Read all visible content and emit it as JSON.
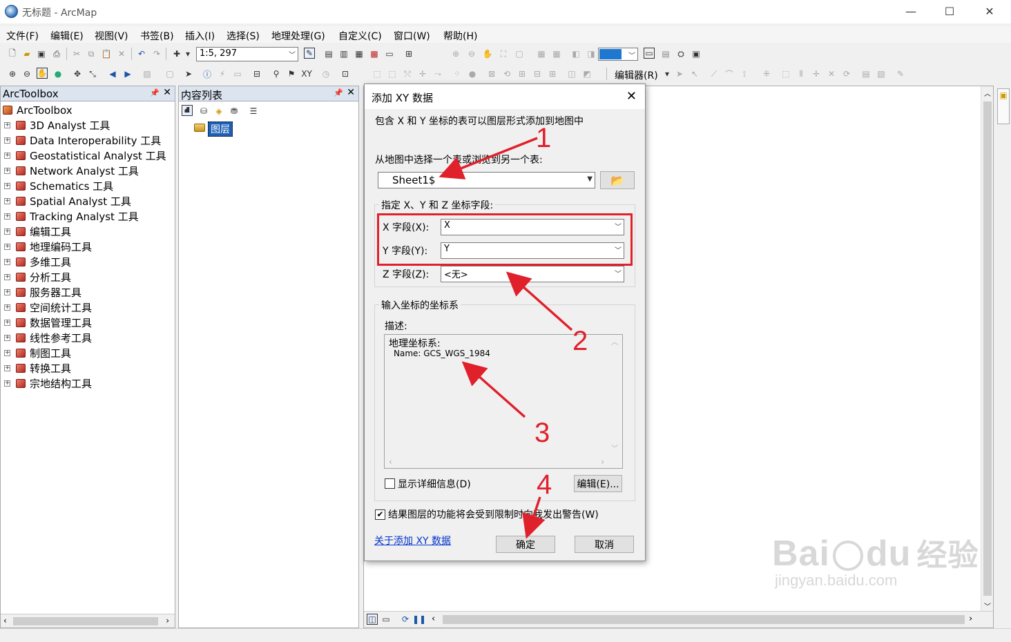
{
  "window": {
    "title": "无标题 - ArcMap",
    "min": "—",
    "max": "☐",
    "close": "✕"
  },
  "menu": [
    "文件(F)",
    "编辑(E)",
    "视图(V)",
    "书签(B)",
    "插入(I)",
    "选择(S)",
    "地理处理(G)",
    "自定义(C)",
    "窗口(W)",
    "帮助(H)"
  ],
  "toolbar": {
    "scale": "1:5, 297",
    "editor_label": "编辑器(R)"
  },
  "toolbox": {
    "title": "ArcToolbox",
    "root": "ArcToolbox",
    "items": [
      "3D Analyst 工具",
      "Data Interoperability 工具",
      "Geostatistical Analyst 工具",
      "Network Analyst 工具",
      "Schematics 工具",
      "Spatial Analyst 工具",
      "Tracking Analyst 工具",
      "编辑工具",
      "地理编码工具",
      "多维工具",
      "分析工具",
      "服务器工具",
      "空间统计工具",
      "数据管理工具",
      "线性参考工具",
      "制图工具",
      "转换工具",
      "宗地结构工具"
    ]
  },
  "toc": {
    "title": "内容列表",
    "layer": "图层"
  },
  "dialog": {
    "title": "添加 XY 数据",
    "intro": "包含 X 和 Y 坐标的表可以图层形式添加到地图中",
    "choose_label": "从地图中选择一个表或浏览到另一个表:",
    "table_value": "Sheet1$",
    "fields_group": "指定 X、Y 和 Z 坐标字段:",
    "x_label": "X 字段(X):",
    "x_value": "X",
    "y_label": "Y 字段(Y):",
    "y_value": "Y",
    "z_label": "Z 字段(Z):",
    "z_value": "<无>",
    "cs_group": "输入坐标的坐标系",
    "desc_label": "描述:",
    "desc_line1": "地理坐标系:",
    "desc_line2": "Name: GCS_WGS_1984",
    "show_details": "显示详细信息(D)",
    "edit_button": "编辑(E)...",
    "warn_label": "结果图层的功能将会受到限制时向我发出警告(W)",
    "warn_checked": true,
    "about_link": "关于添加 XY 数据",
    "ok_button": "确定",
    "cancel_button": "取消"
  },
  "annotations": [
    "1",
    "2",
    "3",
    "4"
  ],
  "annotation_color": "#e0202a",
  "watermark": {
    "line1": "Bai",
    "line2": "du",
    "line3": "经验",
    "sub": "jingyan.baidu.com"
  }
}
